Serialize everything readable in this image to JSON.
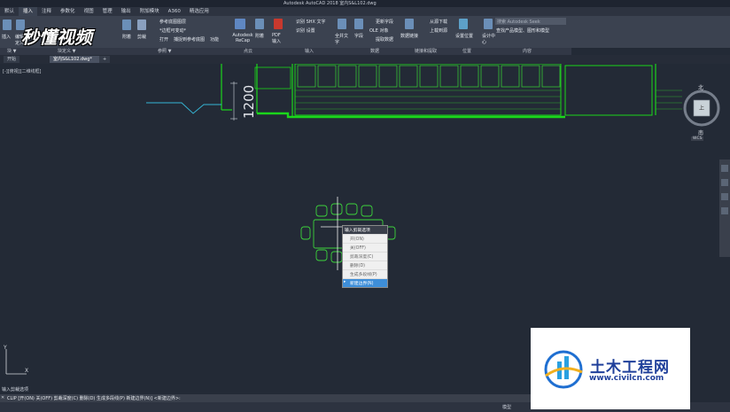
{
  "window": {
    "title": "Autodesk AutoCAD 2018   室内S&L102.dwg"
  },
  "ribbon_tabs": [
    "默认",
    "插入",
    "注释",
    "参数化",
    "视图",
    "管理",
    "输出",
    "附加模块",
    "A360",
    "精选应用"
  ],
  "active_ribbon_tab": 1,
  "ribbon": {
    "btn_insert": "插入",
    "btn_edit_attr": "编辑属性",
    "btn_define_attr": "定义",
    "btn_attach": "附着",
    "btn_clip": "剪裁",
    "ref_underlay": "参考底图图层",
    "ref_frames": "*边框可变动*",
    "ref_snap": "捕捉到参考底图",
    "ref_open": "打开",
    "ref_func": "功能",
    "btn_recap": "Autodesk ReCap",
    "btn_attach2": "附着",
    "btn_pdf": "PDF 输入",
    "import_shx": "识别 SHX 文字",
    "import_settings": "识别 设置",
    "btn_full_text": "全并文字",
    "btn_field": "字段",
    "btn_update_field": "更新字段",
    "btn_ole": "OLE 对象",
    "btn_data_link": "数据链接",
    "btn_extract": "提取数据",
    "btn_download": "从源下载",
    "btn_upload": "上载到源",
    "btn_location": "设置位置",
    "btn_design": "设计中心",
    "search_placeholder": "搜索 Autodesk Seek",
    "content_hint": "查找产品模型、图形和模型"
  },
  "panels": [
    "块 ▼",
    "块定义 ▼",
    "参照 ▼",
    "点云",
    "输入",
    "数据",
    "链接和提取",
    "位置",
    "内容"
  ],
  "file_tabs": [
    "开始",
    "室内S&L102.dwg*"
  ],
  "view_label": "[-][俯视][二维线框]",
  "drawing": {
    "dimension_text": "1200"
  },
  "viewcube": {
    "north": "北",
    "south": "南",
    "top_face": "上",
    "wcs": "WCS"
  },
  "context_menu": {
    "header": "输入剪裁选项",
    "items": [
      "开(ON)",
      "关(OFF)",
      "剪裁深度(C)",
      "删除(D)",
      "生成多段线(P)",
      "新建边界(N)"
    ],
    "selected_index": 5
  },
  "command": {
    "history": "输入剪裁选项",
    "prompt": "CLIP [开(ON) 关(OFF) 剪裁深度(C) 删除(D) 生成多段线(P) 新建边界(N)] <新建边界>:"
  },
  "status": {
    "layout": "模型"
  },
  "watermark": {
    "text": "秒懂视频"
  },
  "logo": {
    "name_cn": "土木工程网",
    "url": "www.civilcn.com"
  },
  "colors": {
    "wall": "#1bd61b",
    "furniture": "#3cd43c",
    "cyan_line": "#35b7d6",
    "selected": "#3e8ed8",
    "background": "#232a36"
  }
}
